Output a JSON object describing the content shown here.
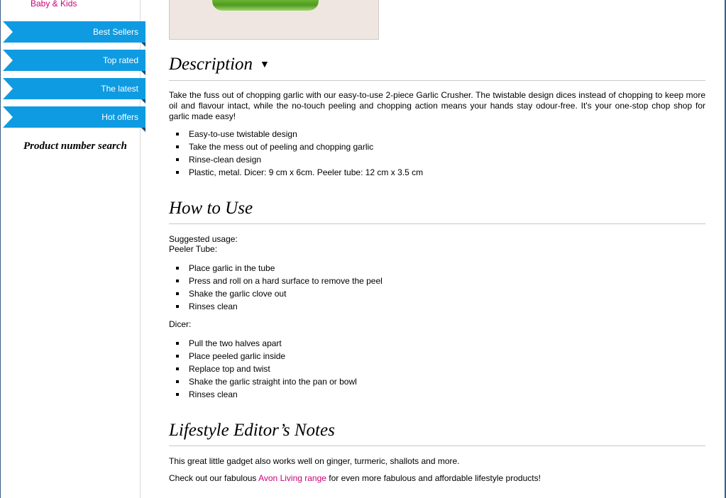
{
  "sidebar": {
    "category_link": "Baby & Kids",
    "ribbons": [
      "Best Sellers",
      "Top rated",
      "The latest",
      "Hot offers"
    ],
    "product_search_label": "Product number search"
  },
  "description": {
    "heading": "Description",
    "toggle": "▼",
    "paragraph": "Take the fuss out of chopping garlic with our easy-to-use 2-piece Garlic Crusher. The twistable design dices instead of chopping to keep more oil and flavour intact, while the no-touch peeling and chopping action means your hands stay odour-free. It's your one-stop chop shop for garlic made easy!",
    "bullets": [
      "Easy-to-use twistable design",
      "Take the mess out of peeling and chopping garlic",
      "Rinse-clean design",
      "Plastic, metal. Dicer: 9 cm x 6cm. Peeler tube: 12 cm x 3.5 cm"
    ]
  },
  "how_to_use": {
    "heading": "How to Use",
    "intro_line1": "Suggested usage:",
    "intro_line2": "Peeler Tube:",
    "peeler_steps": [
      "Place garlic in the tube",
      "Press and roll on a hard surface to remove the peel",
      "Shake the garlic clove out",
      "Rinses clean"
    ],
    "dicer_label": "Dicer:",
    "dicer_steps": [
      "Pull the two halves apart",
      "Place peeled garlic inside",
      "Replace top and twist",
      "Shake the garlic straight into the pan or bowl",
      "Rinses clean"
    ]
  },
  "editor_notes": {
    "heading": "Lifestyle Editor’s Notes",
    "line1": "This great little gadget also works well on ginger, turmeric, shallots and more.",
    "line2_prefix": "Check out our fabulous ",
    "line2_link": "Avon Living range",
    "line2_suffix": " for even more fabulous and affordable lifestyle products!"
  },
  "colors": {
    "ribbon": "#0f9be1",
    "link": "#cc0079"
  }
}
